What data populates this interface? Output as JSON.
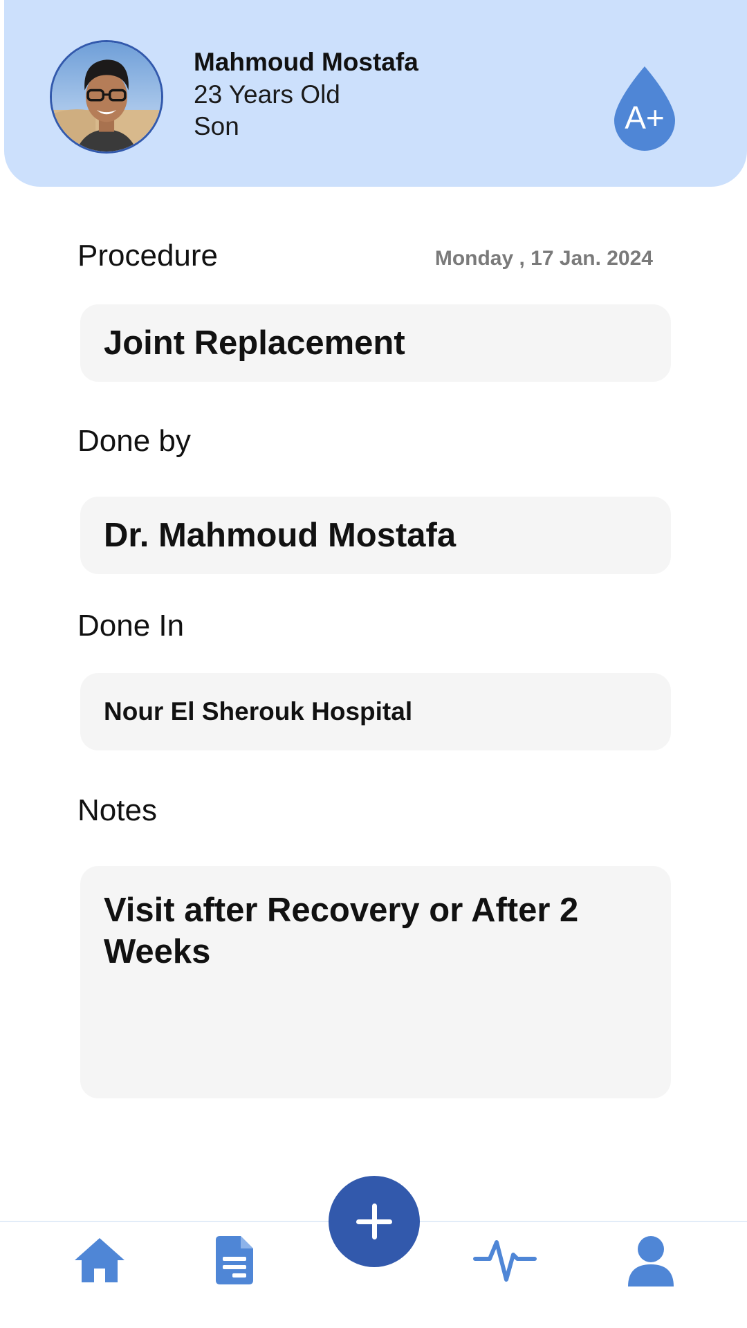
{
  "profile": {
    "name": "Mahmoud Mostafa",
    "age": "23 Years Old",
    "relation": "Son",
    "blood_type": "A+"
  },
  "procedure": {
    "label": "Procedure",
    "date": "Monday , 17 Jan. 2024",
    "value": "Joint Replacement"
  },
  "done_by": {
    "label": "Done by",
    "value": "Dr. Mahmoud Mostafa"
  },
  "done_in": {
    "label": "Done In",
    "value": "Nour El Sherouk Hospital"
  },
  "notes": {
    "label": "Notes",
    "value": "Visit after Recovery or After 2 Weeks"
  },
  "nav": {
    "items": [
      {
        "icon": "home-icon"
      },
      {
        "icon": "document-icon"
      },
      {
        "icon": "plus-icon"
      },
      {
        "icon": "heartbeat-icon"
      },
      {
        "icon": "person-icon"
      }
    ]
  },
  "colors": {
    "header_bg": "#cce0fc",
    "accent": "#3259ac",
    "icon_blue": "#4f86d6",
    "field_bg": "#f5f5f5",
    "date_gray": "#7a7a7a"
  }
}
